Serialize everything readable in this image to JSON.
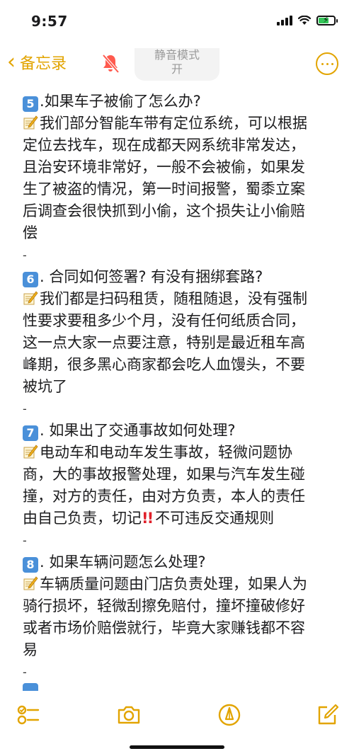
{
  "status_bar": {
    "time": "9:57",
    "battery_charging": true,
    "signal": "strong",
    "wifi": "on"
  },
  "nav": {
    "back_label": "备忘录",
    "silent_mode_title": "静音模式",
    "silent_mode_state": "开",
    "accent_color": "#e2a400"
  },
  "note": {
    "q5": {
      "number": "5",
      "question": ".如果车子被偷了怎么办?",
      "answer_lines": [
        "我们部分智能车带有定位系统，可以根据",
        "定位去找车，现在成都天网系统非常发达，",
        "且治安环境非常好，一般不会被偷，如果发",
        "生了被盗的情况，第一时间报警，蜀黍立案",
        "后调查会很快抓到小偷，这个损失让小偷赔",
        "偿"
      ]
    },
    "sep": "-",
    "q6": {
      "number": "6",
      "question": ". 合同如何签署? 有没有捆绑套路?",
      "answer_lines": [
        "我们都是扫码租赁，随租随退，没有强制",
        "性要求要租多少个月，没有任何纸质合同，",
        "这一点大家一点要注意，特别是最近租车高",
        "峰期，很多黑心商家都会吃人血馒头，不要",
        "被坑了"
      ]
    },
    "q7": {
      "number": "7",
      "question": ". 如果出了交通事故如何处理?",
      "answer_lines": [
        "电动车和电动车发生事故，轻微问题协",
        "商，大的事故报警处理，如果与汽车发生碰",
        "撞，对方的责任，由对方负责，本人的责任"
      ],
      "last_line_prefix": "由自己负责，切记",
      "last_line_suffix": "不可违反交通规则"
    },
    "q8": {
      "number": "8",
      "question": ". 如果车辆问题怎么处理?",
      "answer_lines": [
        "车辆质量问题由门店负责处理，如果人为",
        "骑行损坏，轻微刮擦免赔付，撞坏撞破修好",
        "或者市场价赔偿就行，毕竟大家赚钱都不容",
        "易"
      ]
    }
  },
  "toolbar": {
    "items": [
      "checklist-icon",
      "camera-icon",
      "markup-icon",
      "compose-icon"
    ]
  }
}
